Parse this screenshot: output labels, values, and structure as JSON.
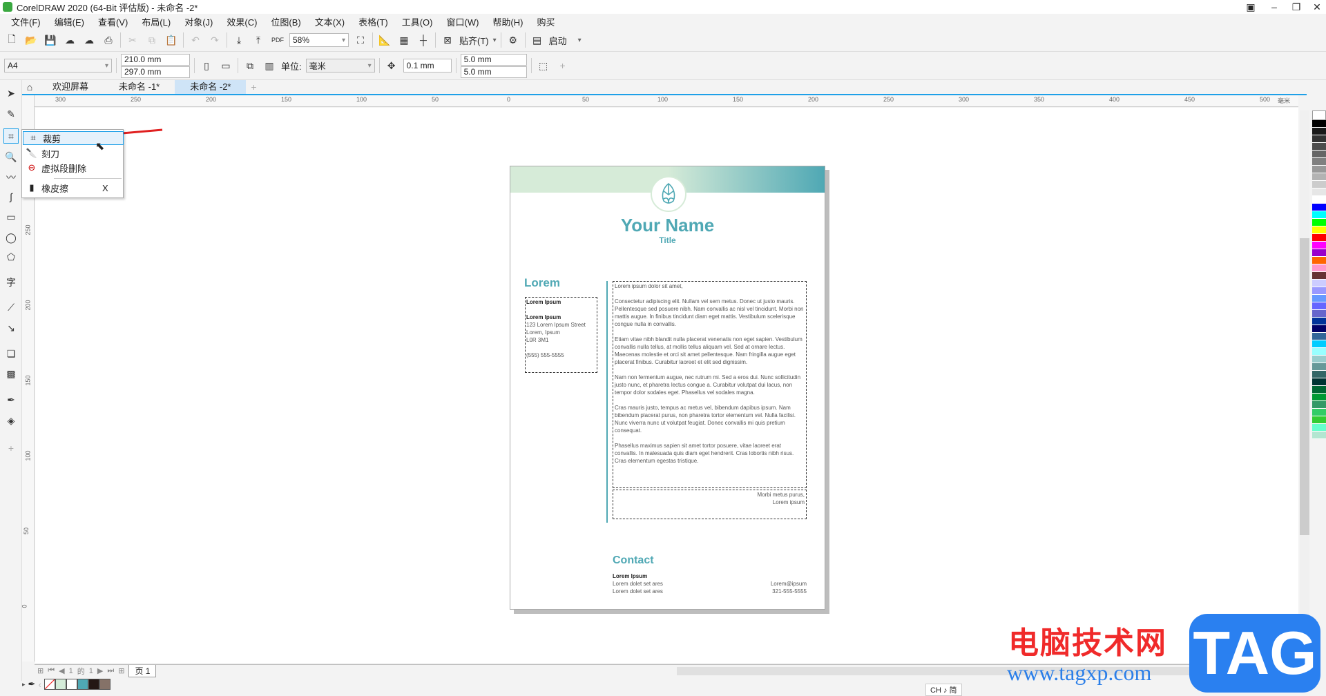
{
  "app": {
    "title": "CorelDRAW 2020 (64-Bit 评估版) - 未命名 -2*"
  },
  "menu": [
    "文件(F)",
    "编辑(E)",
    "查看(V)",
    "布局(L)",
    "对象(J)",
    "效果(C)",
    "位图(B)",
    "文本(X)",
    "表格(T)",
    "工具(O)",
    "窗口(W)",
    "帮助(H)",
    "购买"
  ],
  "toolbar": {
    "zoom": "58%",
    "snap": "贴齐(T)",
    "launch": "启动",
    "pdf": "PDF"
  },
  "property_bar": {
    "paper": "A4",
    "width": "210.0 mm",
    "height": "297.0 mm",
    "unit_label": "单位:",
    "unit": "毫米",
    "nudge": "0.1 mm",
    "dup_x": "5.0 mm",
    "dup_y": "5.0 mm"
  },
  "tabs": [
    "欢迎屏幕",
    "未命名 -1*",
    "未命名 -2*"
  ],
  "ruler": {
    "h_ticks": [
      "300",
      "250",
      "200",
      "150",
      "100",
      "50",
      "0",
      "50",
      "100",
      "150",
      "200",
      "250",
      "300",
      "350",
      "400",
      "450",
      "500"
    ],
    "unit": "毫米",
    "v_ticks": [
      "250",
      "200",
      "150",
      "100",
      "50",
      "0"
    ]
  },
  "flyout": {
    "items": [
      {
        "label": "裁剪",
        "shortcut": ""
      },
      {
        "label": "刻刀",
        "shortcut": ""
      },
      {
        "label": "虚拟段删除",
        "shortcut": ""
      },
      {
        "label": "橡皮擦",
        "shortcut": "X"
      }
    ]
  },
  "document": {
    "name": "Your Name",
    "title": "Title",
    "lorem_heading": "Lorem",
    "left_box": [
      "Lorem Ipsum",
      "",
      "Lorem Ipsum",
      "123 Lorem Ipsum Street",
      "Lorem, Ipsum",
      "L0R 3M1",
      "",
      "(555) 555-5555"
    ],
    "body": [
      "Lorem ipsum dolor sit amet,",
      "Consectetur adipiscing elit. Nullam vel sem metus. Donec ut justo mauris. Pellentesque sed posuere nibh. Nam convallis ac nisl vel tincidunt. Morbi non mattis augue. In finibus tincidunt diam eget mattis. Vestibulum scelerisque congue nulla in convallis.",
      "Etiam vitae nibh blandit nulla placerat venenatis non eget sapien. Vestibulum convallis nulla tellus, at mollis tellus aliquam vel. Sed at ornare lectus. Maecenas molestie et orci sit amet pellentesque. Nam fringilla augue eget placerat finibus. Curabitur laoreet et elit sed dignissim.",
      "Nam non fermentum augue, nec rutrum mi. Sed a eros dui. Nunc sollicitudin justo nunc, et pharetra lectus congue a. Curabitur volutpat dui lacus, non tempor dolor sodales eget. Phasellus vel sodales magna.",
      "Cras mauris justo, tempus ac metus vel, bibendum dapibus ipsum. Nam bibendum placerat purus, non pharetra tortor elementum vel. Nulla facilisi. Nunc viverra nunc ut volutpat feugiat. Donec convallis mi quis pretium consequat.",
      "Phasellus maximus sapien sit amet tortor posuere, vitae laoreet erat convallis. In malesuada quis diam eget hendrerit. Cras lobortis nibh risus. Cras elementum egestas tristique."
    ],
    "sign": [
      "Morbi metus purus,",
      "Lorem ipsum"
    ],
    "contact_heading": "Contact",
    "contact_name": "Lorem Ipsum",
    "contact_lines": [
      "Lorem dolet set ares",
      "Lorem dolet set ares"
    ],
    "contact_right": [
      "Lorem@ipsum",
      "321-555-5555"
    ],
    "accent": "#4fa8b4"
  },
  "page_nav": {
    "current": "1",
    "of": "的",
    "total": "1",
    "page_tab": "页 1"
  },
  "status": {
    "ime": "CH ♪ 简"
  },
  "doc_palette": [
    "#d5ecd9",
    "#ffffff",
    "#4fa8b4",
    "#231815",
    "#857268"
  ],
  "palette": [
    "#000000",
    "#1a1a1a",
    "#333333",
    "#4d4d4d",
    "#666666",
    "#808080",
    "#999999",
    "#b3b3b3",
    "#cccccc",
    "#e6e6e6",
    "#ffffff",
    "#0000ff",
    "#00ffff",
    "#00ff00",
    "#ffff00",
    "#ff0000",
    "#ff00ff",
    "#9900cc",
    "#ff6600",
    "#ff99cc",
    "#663333",
    "#ccccff",
    "#9999ff",
    "#6699ff",
    "#6666ff",
    "#6666cc",
    "#003399",
    "#000066",
    "#336699",
    "#00ccff",
    "#99ffff",
    "#99cccc",
    "#669999",
    "#336666",
    "#003333",
    "#006633",
    "#009933",
    "#339966",
    "#33cc66",
    "#33cc33",
    "#66ffcc",
    "#b3e6d1"
  ],
  "watermark": {
    "cn": "电脑技术网",
    "url": "www.tagxp.com",
    "tag": "TAG"
  }
}
